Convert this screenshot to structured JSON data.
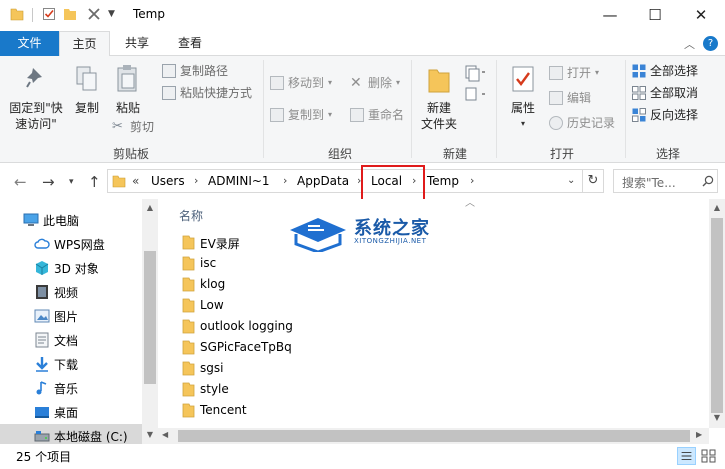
{
  "window": {
    "title": "Temp"
  },
  "tabs": {
    "file": "文件",
    "home": "主页",
    "share": "共享",
    "view": "查看"
  },
  "ribbon": {
    "clipboard": {
      "pin": "固定到\"快速访问\"",
      "pin_line1": "固定到\"快",
      "pin_line2": "速访问\"",
      "copy": "复制",
      "paste": "粘贴",
      "copy_path": "复制路径",
      "paste_shortcut": "粘贴快捷方式",
      "cut": "剪切",
      "label": "剪贴板"
    },
    "organize": {
      "move_to": "移动到",
      "copy_to": "复制到",
      "delete": "删除",
      "rename": "重命名",
      "label": "组织"
    },
    "new": {
      "new_folder_line1": "新建",
      "new_folder_line2": "文件夹",
      "label": "新建"
    },
    "open": {
      "properties": "属性",
      "open": "打开",
      "edit": "编辑",
      "history": "历史记录",
      "label": "打开"
    },
    "select": {
      "select_all": "全部选择",
      "select_none": "全部取消",
      "invert": "反向选择",
      "label": "选择"
    }
  },
  "address": {
    "overflow": "«",
    "crumbs": [
      "Users",
      "ADMINI~1",
      "AppData",
      "Local",
      "Temp"
    ],
    "search_placeholder": "搜索\"Te..."
  },
  "nav": {
    "items": [
      {
        "label": "此电脑",
        "icon": "computer-icon"
      },
      {
        "label": "WPS网盘",
        "icon": "cloud-icon"
      },
      {
        "label": "3D 对象",
        "icon": "cube-icon"
      },
      {
        "label": "视频",
        "icon": "video-icon"
      },
      {
        "label": "图片",
        "icon": "picture-icon"
      },
      {
        "label": "文档",
        "icon": "document-icon"
      },
      {
        "label": "下载",
        "icon": "download-icon"
      },
      {
        "label": "音乐",
        "icon": "music-icon"
      },
      {
        "label": "桌面",
        "icon": "desktop-icon"
      },
      {
        "label": "本地磁盘 (C:)",
        "icon": "drive-icon"
      }
    ]
  },
  "files": {
    "column_name": "名称",
    "items": [
      "EV录屏",
      "isc",
      "klog",
      "Low",
      "outlook logging",
      "SGPicFaceTpBq",
      "sgsi",
      "style",
      "Tencent"
    ]
  },
  "watermark": {
    "title": "系统之家",
    "subtitle": "XITONGZHIJIA.NET"
  },
  "status": {
    "count": "25 个项目"
  },
  "colors": {
    "accent": "#1979ca",
    "highlight_box": "#e01b1b",
    "folder": "#f5c55a"
  }
}
